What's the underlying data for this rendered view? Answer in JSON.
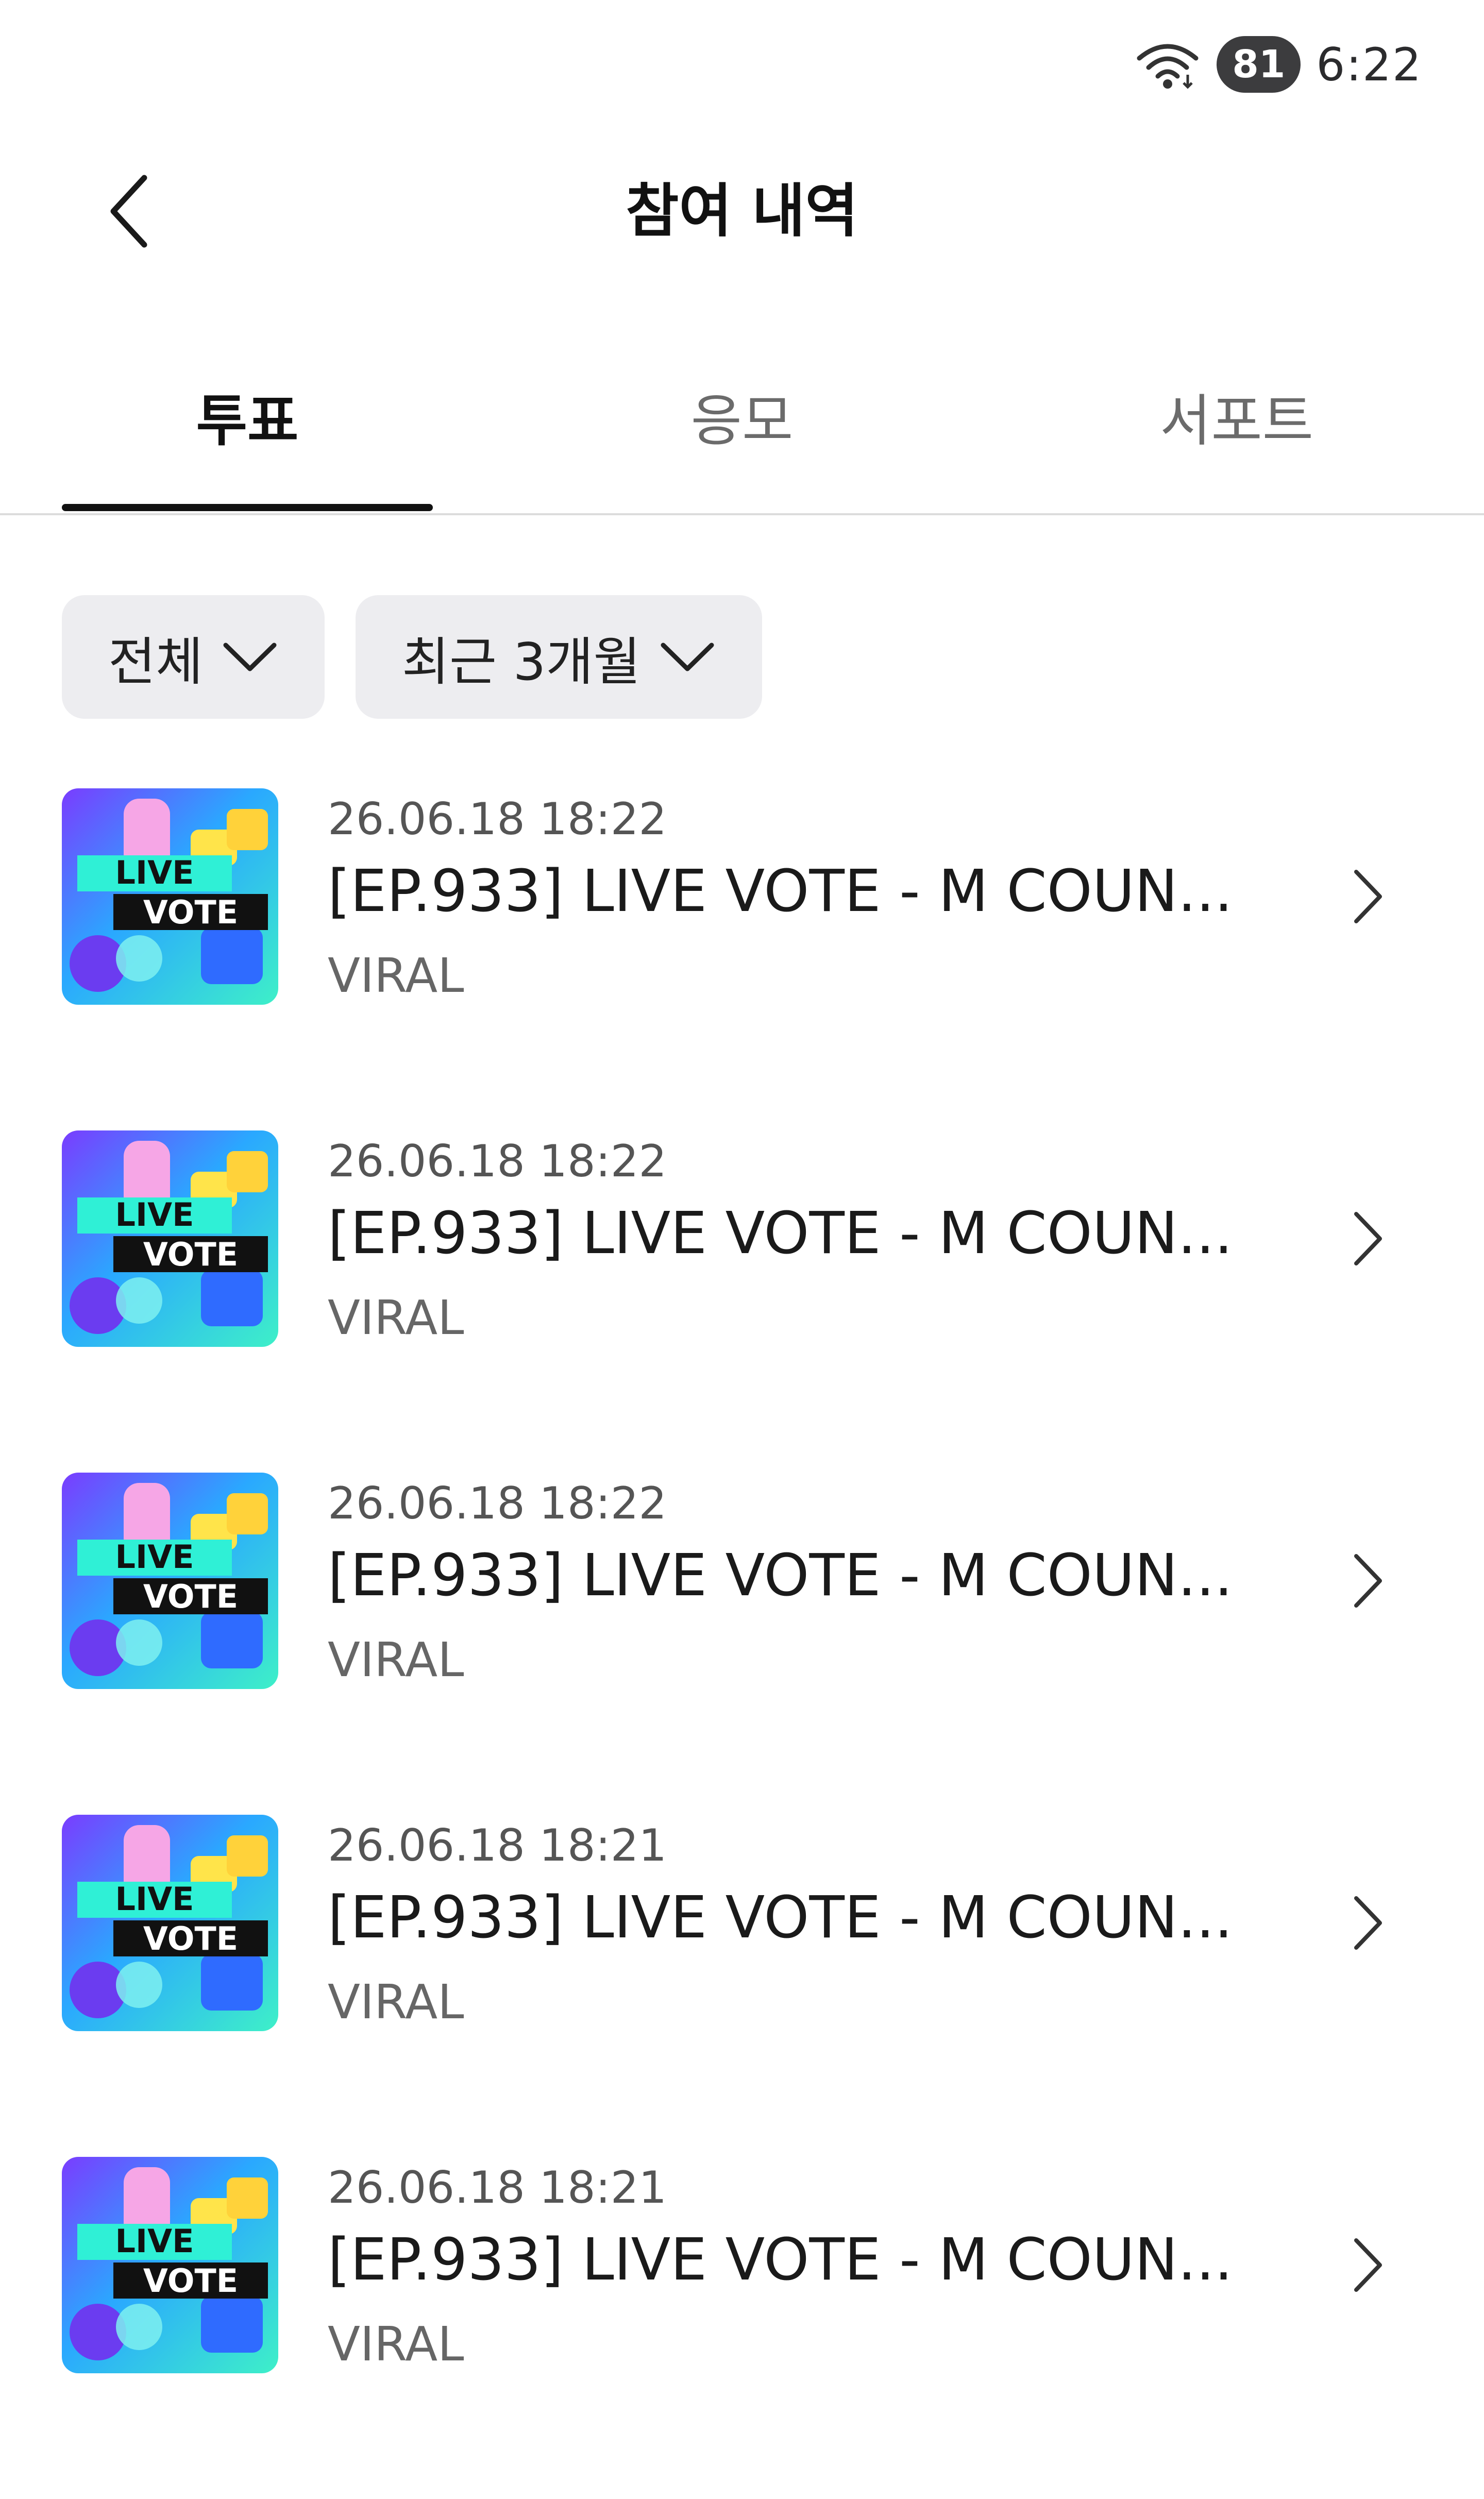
{
  "status_bar": {
    "battery": "81",
    "time": "6:22"
  },
  "header": {
    "title": "참여 내역"
  },
  "tabs": [
    {
      "label": "투표",
      "active": true
    },
    {
      "label": "응모",
      "active": false
    },
    {
      "label": "서포트",
      "active": false
    }
  ],
  "filters": {
    "type": "전체",
    "period": "최근 3개월"
  },
  "thumbnail": {
    "line1": "LIVE",
    "line2": "VOTE"
  },
  "items": [
    {
      "date": "26.06.18 18:22",
      "title": "[EP.933] LIVE VOTE - M COUN...",
      "subtitle": "VIRAL"
    },
    {
      "date": "26.06.18 18:22",
      "title": "[EP.933] LIVE VOTE - M COUN...",
      "subtitle": "VIRAL"
    },
    {
      "date": "26.06.18 18:22",
      "title": "[EP.933] LIVE VOTE - M COUN...",
      "subtitle": "VIRAL"
    },
    {
      "date": "26.06.18 18:21",
      "title": "[EP.933] LIVE VOTE - M COUN...",
      "subtitle": "VIRAL"
    },
    {
      "date": "26.06.18 18:21",
      "title": "[EP.933] LIVE VOTE - M COUN...",
      "subtitle": "VIRAL"
    }
  ],
  "colors": {
    "accent": "#111111",
    "chip_bg": "#ededf0",
    "divider": "#dcdcdc"
  }
}
